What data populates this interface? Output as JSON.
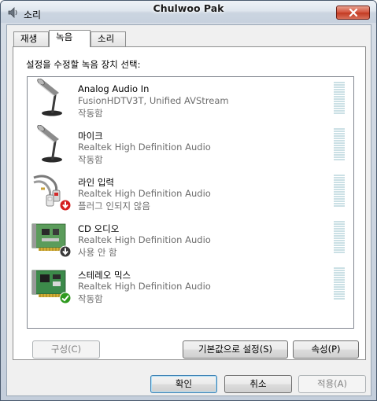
{
  "window": {
    "title": "소리",
    "user": "Chulwoo Pak"
  },
  "tabs": [
    {
      "label": "재생",
      "active": false
    },
    {
      "label": "녹음",
      "active": true
    },
    {
      "label": "소리",
      "active": false
    }
  ],
  "recording": {
    "instruction": "설정을 수정할 녹음 장치 선택:",
    "devices": [
      {
        "name": "Analog Audio In",
        "description": "FusionHDTV3T, Unified AVStream",
        "status": "작동함",
        "icon": "microphone-icon",
        "badge": null
      },
      {
        "name": "마이크",
        "description": "Realtek High Definition Audio",
        "status": "작동함",
        "icon": "microphone-icon",
        "badge": null
      },
      {
        "name": "라인 입력",
        "description": "Realtek High Definition Audio",
        "status": "플러그 인되지 않음",
        "icon": "rca-cable-icon",
        "badge": "unplugged-badge-icon"
      },
      {
        "name": "CD 오디오",
        "description": "Realtek High Definition Audio",
        "status": "사용 안 함",
        "icon": "sound-card-icon",
        "badge": "disabled-badge-icon"
      },
      {
        "name": "스테레오 믹스",
        "description": "Realtek High Definition Audio",
        "status": "작동함",
        "icon": "sound-card-icon",
        "badge": "default-check-icon"
      }
    ]
  },
  "buttons": {
    "configure": "구성(C)",
    "set_default": "기본값으로 설정(S)",
    "properties": "속성(P)",
    "ok": "확인",
    "cancel": "취소",
    "apply": "적용(A)"
  },
  "colors": {
    "title_gradient_top": "#eef2f7",
    "close_red": "#c23a22",
    "meter_cyan": "#cbe0e5",
    "badge_green": "#2f9a1f",
    "badge_red": "#d52020"
  }
}
